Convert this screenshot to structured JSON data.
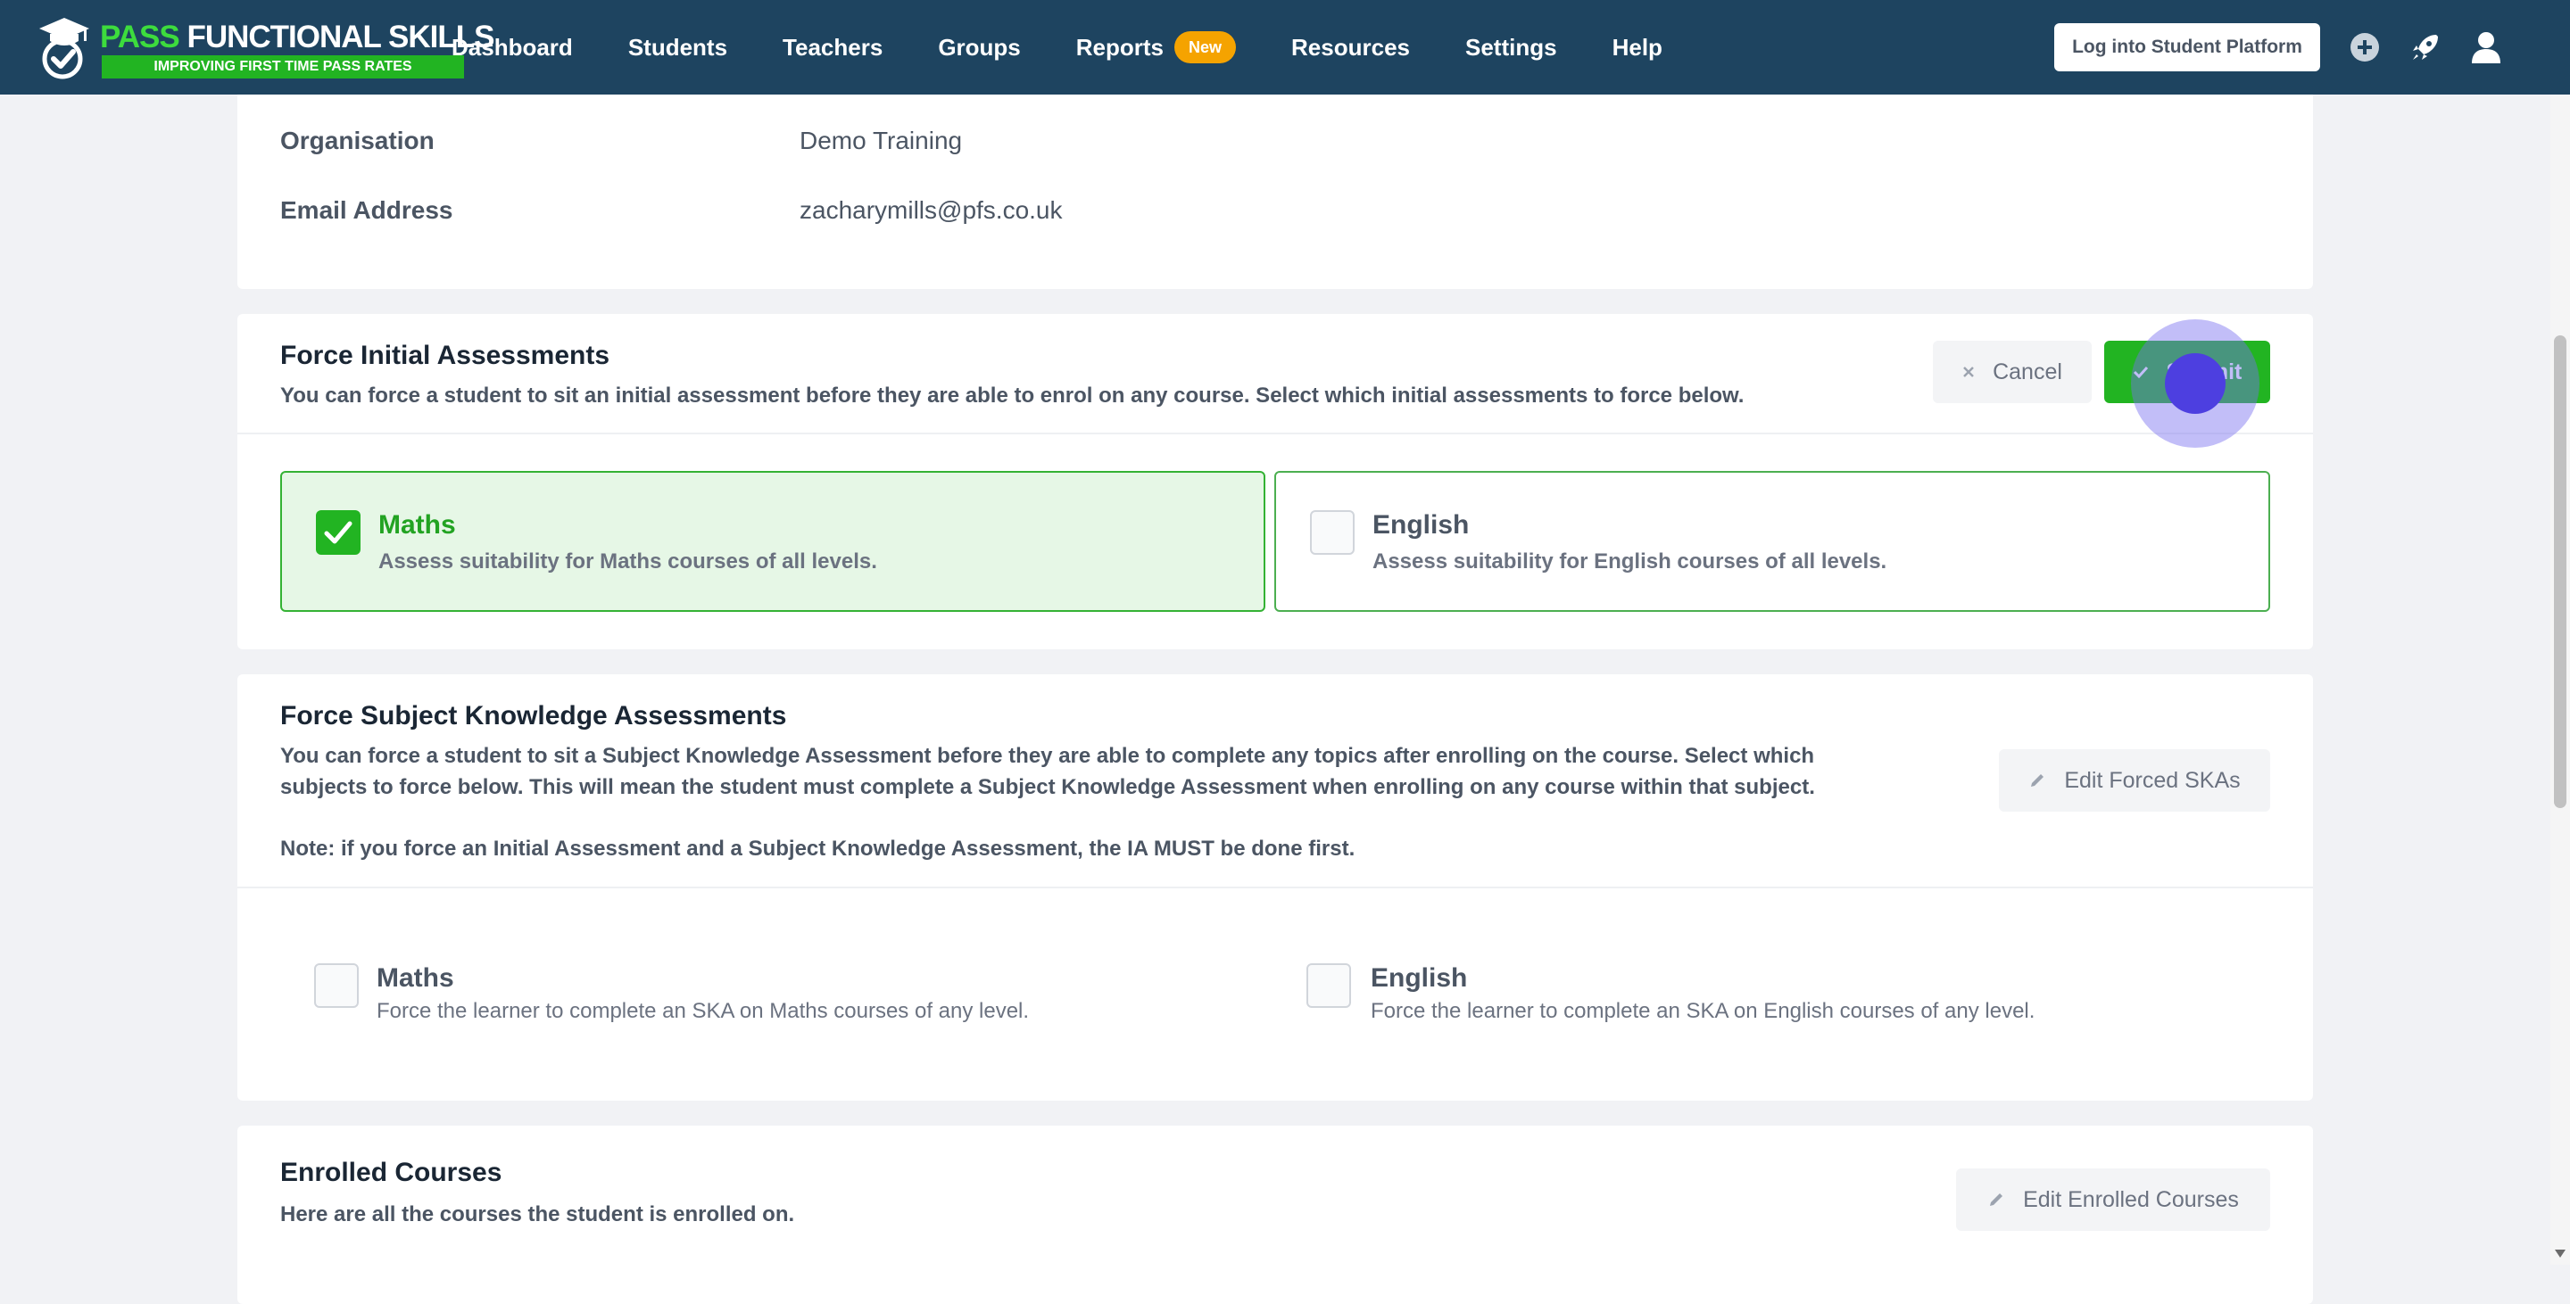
{
  "brand": {
    "title_highlight": "PASS",
    "title_rest": "FUNCTIONAL SKILLS",
    "tagline": "IMPROVING FIRST TIME PASS RATES"
  },
  "nav": {
    "items": [
      "Dashboard",
      "Students",
      "Teachers",
      "Groups",
      "Reports",
      "Resources",
      "Settings",
      "Help"
    ],
    "reports_badge": "New",
    "login_button": "Log into Student Platform",
    "icons": [
      "plus-circle-icon",
      "rocket-icon",
      "user-icon"
    ]
  },
  "details": {
    "organisation_label": "Organisation",
    "organisation_value": "Demo Training",
    "email_label": "Email Address",
    "email_value": "zacharymills@pfs.co.uk"
  },
  "force_ia": {
    "title": "Force Initial Assessments",
    "description": "You can force a student to sit an initial assessment before they are able to enrol on any course. Select which initial assessments to force below.",
    "cancel_label": "Cancel",
    "submit_label": "Submit",
    "options": [
      {
        "title": "Maths",
        "description": "Assess suitability for Maths courses of all levels.",
        "checked": true
      },
      {
        "title": "English",
        "description": "Assess suitability for English courses of all levels.",
        "checked": false
      }
    ]
  },
  "force_ska": {
    "title": "Force Subject Knowledge Assessments",
    "description": "You can force a student to sit a Subject Knowledge Assessment before they are able to complete any topics after enrolling on the course. Select which subjects to force below. This will mean the student must complete a Subject Knowledge Assessment when enrolling on any course within that subject.",
    "note": "Note: if you force an Initial Assessment and a Subject Knowledge Assessment, the IA MUST be done first.",
    "edit_label": "Edit Forced SKAs",
    "options": [
      {
        "title": "Maths",
        "description": "Force the learner to complete an SKA on Maths courses of any level.",
        "checked": false
      },
      {
        "title": "English",
        "description": "Force the learner to complete an SKA on English courses of any level.",
        "checked": false
      }
    ]
  },
  "enrolled": {
    "title": "Enrolled Courses",
    "description": "Here are all the courses the student is enrolled on.",
    "edit_label": "Edit Enrolled Courses"
  },
  "colors": {
    "navbar": "#1e4460",
    "brand_green": "#22b422",
    "badge_orange": "#f5a300",
    "selected_bg": "#e6f7e6"
  }
}
